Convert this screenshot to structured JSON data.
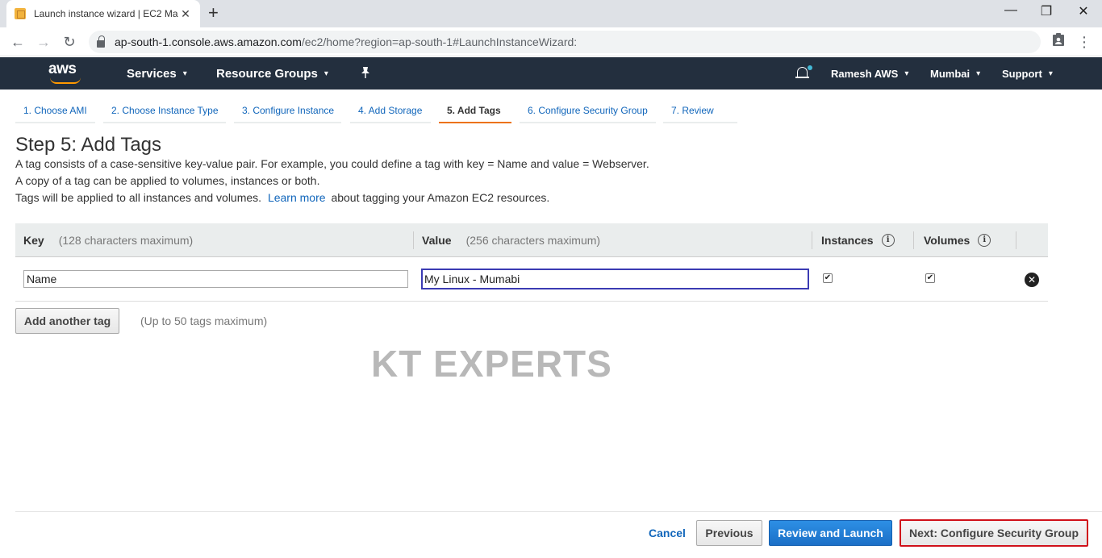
{
  "browser": {
    "tab_title": "Launch instance wizard | EC2 Ma",
    "tab_close": "✕",
    "new_tab": "+",
    "url_host": "ap-south-1.console.aws.amazon.com",
    "url_path": "/ec2/home?region=ap-south-1#LaunchInstanceWizard:",
    "minimize": "—",
    "restore": "❐",
    "close": "✕"
  },
  "aws_nav": {
    "logo_text": "aws",
    "services": "Services",
    "resource_groups": "Resource Groups",
    "user": "Ramesh AWS",
    "region": "Mumbai",
    "support": "Support",
    "caret": "▾"
  },
  "steps": [
    {
      "label": "1. Choose AMI"
    },
    {
      "label": "2. Choose Instance Type"
    },
    {
      "label": "3. Configure Instance"
    },
    {
      "label": "4. Add Storage"
    },
    {
      "label": "5. Add Tags"
    },
    {
      "label": "6. Configure Security Group"
    },
    {
      "label": "7. Review"
    }
  ],
  "page": {
    "title": "Step 5: Add Tags",
    "desc1": "A tag consists of a case-sensitive key-value pair. For example, you could define a tag with key = Name and value = Webserver.",
    "desc2": "A copy of a tag can be applied to volumes, instances or both.",
    "desc3_pre": "Tags will be applied to all instances and volumes.",
    "learn_more": "Learn more",
    "desc3_post": "about tagging your Amazon EC2 resources."
  },
  "table": {
    "key_header": "Key",
    "key_hint": "(128 characters maximum)",
    "value_header": "Value",
    "value_hint": "(256 characters maximum)",
    "instances_header": "Instances",
    "volumes_header": "Volumes",
    "info_glyph": "i",
    "row": {
      "key": "Name",
      "value": "My Linux - Mumabi",
      "instances_checked": true,
      "volumes_checked": true,
      "check_glyph": "✔",
      "remove_glyph": "✕"
    }
  },
  "add_tag_button": "Add another tag",
  "tag_limit": "(Up to 50 tags maximum)",
  "watermark": "KT EXPERTS",
  "footer": {
    "cancel": "Cancel",
    "previous": "Previous",
    "review_launch": "Review and Launch",
    "next": "Next: Configure Security Group"
  },
  "colors": {
    "nav_bg": "#232f3e",
    "accent_orange": "#ec7211",
    "link_blue": "#1166bb",
    "primary_blue": "#1b6fc7",
    "highlight_red": "#d0111a"
  }
}
